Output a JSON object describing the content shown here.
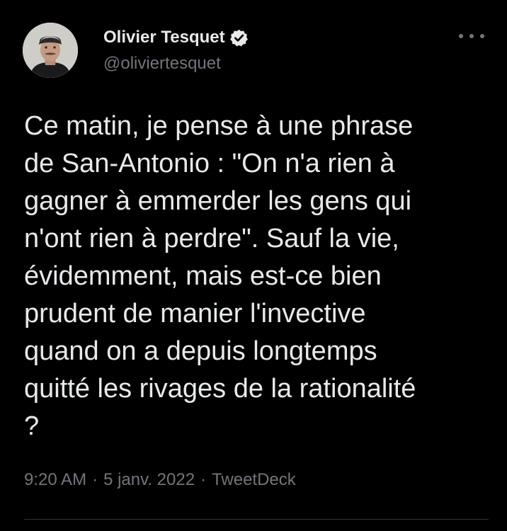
{
  "author": {
    "display_name": "Olivier Tesquet",
    "handle": "@oliviertesquet",
    "verified": true
  },
  "tweet": {
    "text": "Ce matin, je pense à une phrase\nde San-Antonio : \"On n'a rien à\ngagner à emmerder les gens qui\nn'ont rien à perdre\". Sauf la vie,\névidemment, mais est-ce bien\nprudent de manier l'invective\nquand on a depuis longtemps\nquitté les rivages de la rationalité\n?",
    "time": "9:20 AM",
    "separator": "·",
    "date": "5 janv. 2022",
    "source": "TweetDeck"
  },
  "icons": {
    "verified": "verified-badge-icon",
    "more": "more-options-icon"
  },
  "colors": {
    "background": "#000000",
    "primary_text": "#e7e9ea",
    "secondary_text": "#71767b",
    "divider": "#2f3336"
  }
}
